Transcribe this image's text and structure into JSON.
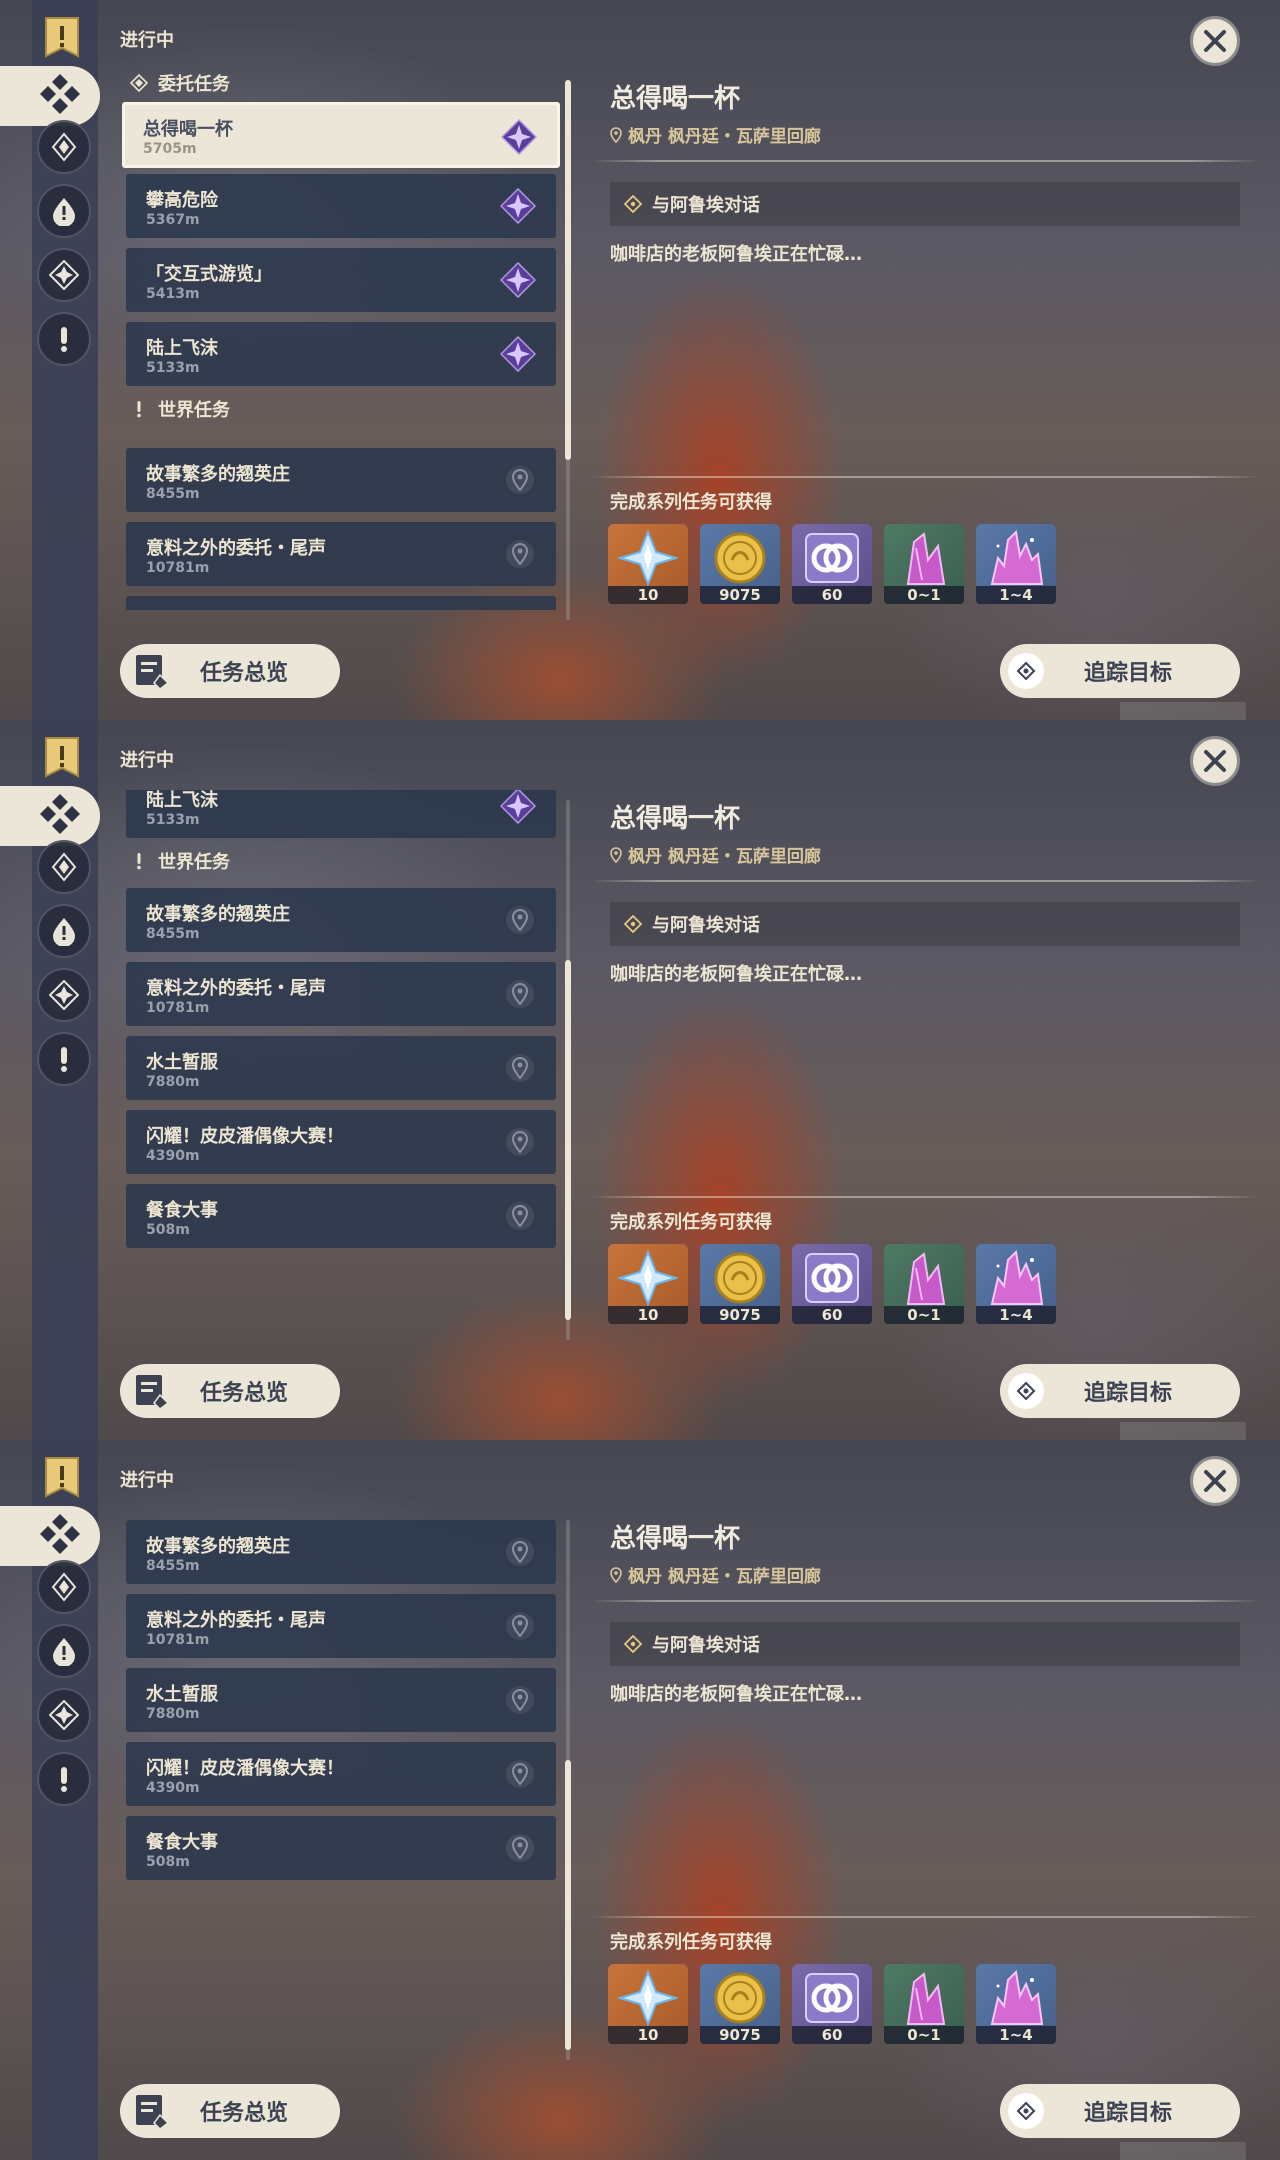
{
  "header": {
    "section_label": "进行中"
  },
  "categories": {
    "commission": "委托任务",
    "world": "世界任务"
  },
  "quests": [
    {
      "name": "总得喝一杯",
      "distance": "5705m",
      "type": "commission"
    },
    {
      "name": "攀高危险",
      "distance": "5367m",
      "type": "commission"
    },
    {
      "name": "「交互式游览」",
      "distance": "5413m",
      "type": "commission"
    },
    {
      "name": "陆上飞沫",
      "distance": "5133m",
      "type": "commission"
    },
    {
      "name": "故事繁多的翘英庄",
      "distance": "8455m",
      "type": "world"
    },
    {
      "name": "意料之外的委托・尾声",
      "distance": "10781m",
      "type": "world"
    },
    {
      "name": "水土暂服",
      "distance": "7880m",
      "type": "world"
    },
    {
      "name": "闪耀！皮皮潘偶像大赛！",
      "distance": "4390m",
      "type": "world"
    },
    {
      "name": "餐食大事",
      "distance": "508m",
      "type": "world"
    }
  ],
  "detail": {
    "title": "总得喝一杯",
    "location": "枫丹 枫丹廷・瓦萨里回廊",
    "objective": "与阿鲁埃对话",
    "description": "咖啡店的老板阿鲁埃正在忙碌…",
    "rewards_label": "完成系列任务可获得",
    "rewards": [
      {
        "icon": "primogem-icon",
        "count": "10"
      },
      {
        "icon": "mora-icon",
        "count": "9075"
      },
      {
        "icon": "exp-icon",
        "count": "60"
      },
      {
        "icon": "crystal-chunk-icon",
        "count": "0~1"
      },
      {
        "icon": "crystal-cluster-icon",
        "count": "1~4"
      }
    ]
  },
  "buttons": {
    "overview": "任务总览",
    "track": "追踪目标"
  },
  "scroll_states": [
    "top",
    "middle",
    "bottom"
  ],
  "colors": {
    "accent_cream": "#ece6d8",
    "item_bg": "#2e384e",
    "location_gold": "#d8c79c"
  }
}
